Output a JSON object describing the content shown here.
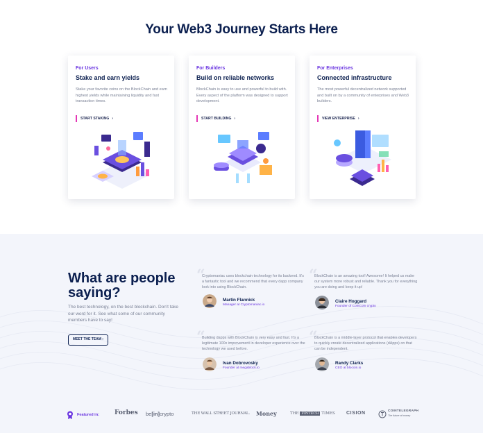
{
  "hero": {
    "title": "Your Web3 Journey Starts Here"
  },
  "cards": [
    {
      "kicker": "For Users",
      "title": "Stake and earn yields",
      "description": "Stake your favorite coins on the BlockChain and earn highest yields while maintaining liquidity and fast transaction times.",
      "cta": "START STAKING",
      "arrow": "›"
    },
    {
      "kicker": "For Builders",
      "title": "Build on reliable networks",
      "description": "BlockChain is easy to use and powerful to build with. Every aspect of the platform was designed to support development.",
      "cta": "START BUILDING",
      "arrow": "›"
    },
    {
      "kicker": "For Enterprises",
      "title": "Connected infrastructure",
      "description": "The most powerful decentralized network supported and built on by a community of enterprises and Web3 builders.",
      "cta": "VIEW ENTERPRISE",
      "arrow": "›"
    }
  ],
  "testimonials_section": {
    "title": "What are people saying?",
    "description": "The best technology, on the best blockchain. Don't take our word for it. See what some of our community members have to say!",
    "button": "MEET THE TEAM",
    "arrow": "›",
    "quote_glyph": "“",
    "quotes": [
      {
        "text": "Cryptomaniac uses blockchain technology for its backend. It's a fantastic tool and we recommend that every dapp company look into using BlockChain.",
        "name": "Martin Flannick",
        "role": "Manager at Cryptomaniac.io"
      },
      {
        "text": "BlockChain is an amazing tool! Awesome! It helped us make our system more robust and reliable. Thank you for everything you are doing and keep it up!",
        "name": "Claire Hoggard",
        "role": "Founder of CoinCoin crypto"
      },
      {
        "text": "Building dapps with BlockChain is very easy and fast. It's a legitimate 100x improvement in developer experience over the technology we used before.",
        "name": "Ivan Dobrovosky",
        "role": "Founder at megablock.io"
      },
      {
        "text": "BlockChain is a middle-layer protocol that enables developers to quickly create decentralized applications (dApps) on that can be independent.",
        "name": "Randy Clarks",
        "role": "CEO at blocoin.io"
      }
    ]
  },
  "featured": {
    "label": "Featured in:",
    "logos": {
      "forbes": "Forbes",
      "beincrypto_a": "be",
      "beincrypto_b": "[in]",
      "beincrypto_c": "crypto",
      "wsj": "THE WALL STREET JOURNAL.",
      "money": "Money",
      "fintech_a": "THE",
      "fintech_b": "FINTECH",
      "fintech_c": "TIMES",
      "cision": "CISION",
      "cointelegraph": "COINTELEGRAPH",
      "cointelegraph_tag": "The future of money"
    }
  },
  "colors": {
    "accent": "#6a35e0",
    "navy": "#0b1f4f",
    "pink": "#e536b6",
    "section_bg": "#f3f5fb"
  }
}
